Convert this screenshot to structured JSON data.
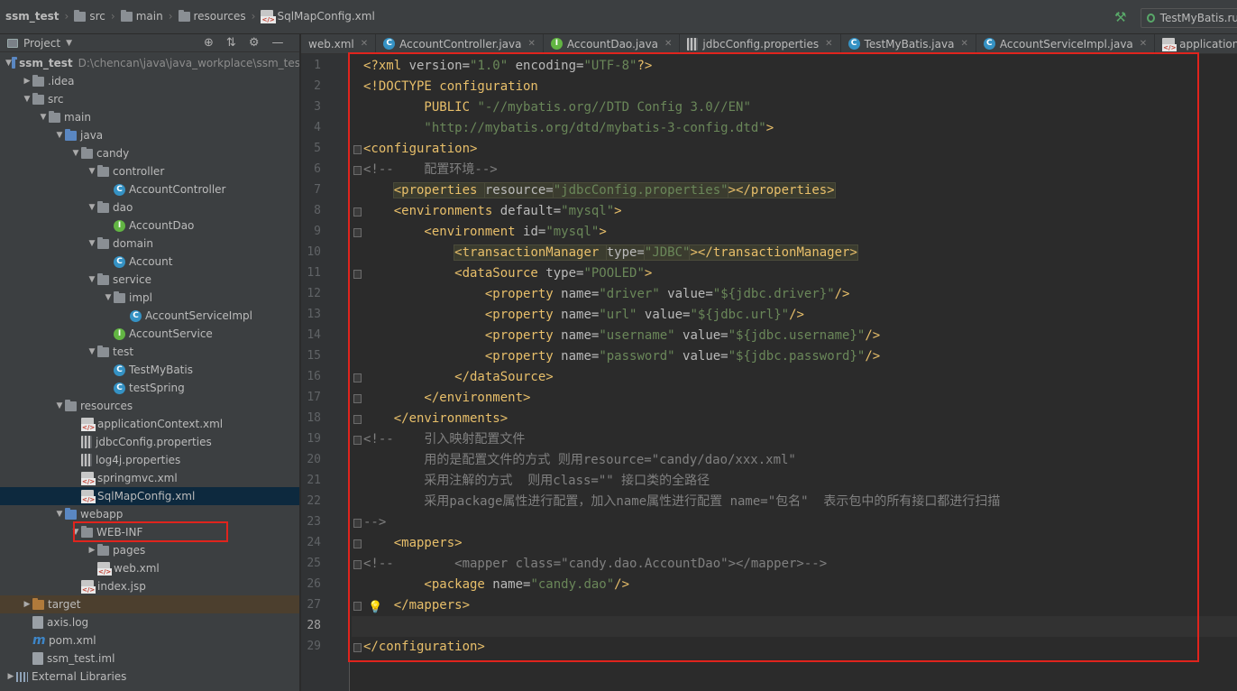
{
  "breadcrumbs": [
    "ssm_test",
    "src",
    "main",
    "resources",
    "SqlMapConfig.xml"
  ],
  "run_config": "TestMyBatis.ru",
  "sidebar": {
    "title": "Project",
    "project_path": "D:\\chencan\\java\\java_workplace\\ssm_tes",
    "nodes": [
      {
        "label": "ssm_test",
        "depth": 0,
        "arrow": "down",
        "icon": "folder-blue",
        "bold": true
      },
      {
        "label": ".idea",
        "depth": 1,
        "arrow": "right",
        "icon": "folder"
      },
      {
        "label": "src",
        "depth": 1,
        "arrow": "down",
        "icon": "folder"
      },
      {
        "label": "main",
        "depth": 2,
        "arrow": "down",
        "icon": "folder"
      },
      {
        "label": "java",
        "depth": 3,
        "arrow": "down",
        "icon": "folder-blue"
      },
      {
        "label": "candy",
        "depth": 4,
        "arrow": "down",
        "icon": "folder"
      },
      {
        "label": "controller",
        "depth": 5,
        "arrow": "down",
        "icon": "folder"
      },
      {
        "label": "AccountController",
        "depth": 6,
        "arrow": "",
        "icon": "class"
      },
      {
        "label": "dao",
        "depth": 5,
        "arrow": "down",
        "icon": "folder"
      },
      {
        "label": "AccountDao",
        "depth": 6,
        "arrow": "",
        "icon": "interface"
      },
      {
        "label": "domain",
        "depth": 5,
        "arrow": "down",
        "icon": "folder"
      },
      {
        "label": "Account",
        "depth": 6,
        "arrow": "",
        "icon": "class"
      },
      {
        "label": "service",
        "depth": 5,
        "arrow": "down",
        "icon": "folder"
      },
      {
        "label": "impl",
        "depth": 6,
        "arrow": "down",
        "icon": "folder"
      },
      {
        "label": "AccountServiceImpl",
        "depth": 7,
        "arrow": "",
        "icon": "class"
      },
      {
        "label": "AccountService",
        "depth": 6,
        "arrow": "",
        "icon": "interface"
      },
      {
        "label": "test",
        "depth": 5,
        "arrow": "down",
        "icon": "folder"
      },
      {
        "label": "TestMyBatis",
        "depth": 6,
        "arrow": "",
        "icon": "class"
      },
      {
        "label": "testSpring",
        "depth": 6,
        "arrow": "",
        "icon": "class"
      },
      {
        "label": "resources",
        "depth": 3,
        "arrow": "down",
        "icon": "folder"
      },
      {
        "label": "applicationContext.xml",
        "depth": 4,
        "arrow": "",
        "icon": "xml"
      },
      {
        "label": "jdbcConfig.properties",
        "depth": 4,
        "arrow": "",
        "icon": "props"
      },
      {
        "label": "log4j.properties",
        "depth": 4,
        "arrow": "",
        "icon": "props"
      },
      {
        "label": "springmvc.xml",
        "depth": 4,
        "arrow": "",
        "icon": "xml"
      },
      {
        "label": "SqlMapConfig.xml",
        "depth": 4,
        "arrow": "",
        "icon": "xml",
        "selected": true
      },
      {
        "label": "webapp",
        "depth": 3,
        "arrow": "down",
        "icon": "folder-blue"
      },
      {
        "label": "WEB-INF",
        "depth": 4,
        "arrow": "down",
        "icon": "folder"
      },
      {
        "label": "pages",
        "depth": 5,
        "arrow": "right",
        "icon": "folder"
      },
      {
        "label": "web.xml",
        "depth": 5,
        "arrow": "",
        "icon": "xml"
      },
      {
        "label": "index.jsp",
        "depth": 4,
        "arrow": "",
        "icon": "jsp"
      },
      {
        "label": "target",
        "depth": 1,
        "arrow": "right",
        "icon": "folder-brown",
        "target": true
      },
      {
        "label": "axis.log",
        "depth": 1,
        "arrow": "",
        "icon": "file"
      },
      {
        "label": "pom.xml",
        "depth": 1,
        "arrow": "",
        "icon": "maven"
      },
      {
        "label": "ssm_test.iml",
        "depth": 1,
        "arrow": "",
        "icon": "file"
      },
      {
        "label": "External Libraries",
        "depth": 0,
        "arrow": "right",
        "icon": "libs"
      }
    ]
  },
  "tabs": [
    {
      "label": "web.xml",
      "icon": "xml"
    },
    {
      "label": "AccountController.java",
      "icon": "class"
    },
    {
      "label": "AccountDao.java",
      "icon": "interface"
    },
    {
      "label": "jdbcConfig.properties",
      "icon": "props"
    },
    {
      "label": "TestMyBatis.java",
      "icon": "class"
    },
    {
      "label": "AccountServiceImpl.java",
      "icon": "class"
    },
    {
      "label": "applicationCont",
      "icon": "xml"
    }
  ],
  "editor": {
    "lines": [
      [
        [
          "t",
          "<?xml "
        ],
        [
          "a",
          "version="
        ],
        [
          "v",
          "\"1.0\""
        ],
        [
          "a",
          " encoding="
        ],
        [
          "v",
          "\"UTF-8\""
        ],
        [
          "t",
          "?>"
        ]
      ],
      [
        [
          "t",
          "<!DOCTYPE configuration"
        ]
      ],
      [
        [
          "t",
          "        PUBLIC "
        ],
        [
          "v",
          "\"-//mybatis.org//DTD Config 3.0//EN\""
        ]
      ],
      [
        [
          "v",
          "        \"http://mybatis.org/dtd/mybatis-3-config.dtd\""
        ],
        [
          "t",
          ">"
        ]
      ],
      [
        [
          "t",
          "<configuration>"
        ]
      ],
      [
        [
          "c",
          "<!--    配置环境-->"
        ]
      ],
      [
        [
          "pl",
          "    "
        ],
        [
          "th",
          "<properties "
        ],
        [
          "ah",
          "resource="
        ],
        [
          "vh",
          "\"jdbcConfig.properties\""
        ],
        [
          "th",
          "></properties>"
        ]
      ],
      [
        [
          "t",
          "    <environments "
        ],
        [
          "a",
          "default="
        ],
        [
          "v",
          "\"mysql\""
        ],
        [
          "t",
          ">"
        ]
      ],
      [
        [
          "t",
          "        <environment "
        ],
        [
          "a",
          "id="
        ],
        [
          "v",
          "\"mysql\""
        ],
        [
          "t",
          ">"
        ]
      ],
      [
        [
          "pl",
          "            "
        ],
        [
          "th",
          "<transactionManager "
        ],
        [
          "ah",
          "type="
        ],
        [
          "vh",
          "\"JDBC\""
        ],
        [
          "th",
          "></transactionManager>"
        ]
      ],
      [
        [
          "t",
          "            <dataSource "
        ],
        [
          "a",
          "type="
        ],
        [
          "v",
          "\"POOLED\""
        ],
        [
          "t",
          ">"
        ]
      ],
      [
        [
          "t",
          "                <property "
        ],
        [
          "a",
          "name="
        ],
        [
          "v",
          "\"driver\""
        ],
        [
          "a",
          " value="
        ],
        [
          "v",
          "\"${jdbc.driver}\""
        ],
        [
          "t",
          "/>"
        ]
      ],
      [
        [
          "t",
          "                <property "
        ],
        [
          "a",
          "name="
        ],
        [
          "v",
          "\"url\""
        ],
        [
          "a",
          " value="
        ],
        [
          "v",
          "\"${jdbc.url}\""
        ],
        [
          "t",
          "/>"
        ]
      ],
      [
        [
          "t",
          "                <property "
        ],
        [
          "a",
          "name="
        ],
        [
          "v",
          "\"username\""
        ],
        [
          "a",
          " value="
        ],
        [
          "v",
          "\"${jdbc.username}\""
        ],
        [
          "t",
          "/>"
        ]
      ],
      [
        [
          "t",
          "                <property "
        ],
        [
          "a",
          "name="
        ],
        [
          "v",
          "\"password\""
        ],
        [
          "a",
          " value="
        ],
        [
          "v",
          "\"${jdbc.password}\""
        ],
        [
          "t",
          "/>"
        ]
      ],
      [
        [
          "t",
          "            </dataSource>"
        ]
      ],
      [
        [
          "t",
          "        </environment>"
        ]
      ],
      [
        [
          "t",
          "    </environments>"
        ]
      ],
      [
        [
          "c",
          "<!--    引入映射配置文件"
        ]
      ],
      [
        [
          "c",
          "        用的是配置文件的方式 则用resource=\"candy/dao/xxx.xml\""
        ]
      ],
      [
        [
          "c",
          "        采用注解的方式  则用class=\"\" 接口类的全路径"
        ]
      ],
      [
        [
          "c",
          "        采用package属性进行配置，加入name属性进行配置 name=\"包名\"  表示包中的所有接口都进行扫描"
        ]
      ],
      [
        [
          "c",
          "-->"
        ]
      ],
      [
        [
          "t",
          "    <mappers>"
        ]
      ],
      [
        [
          "c",
          "<!--        <mapper class=\"candy.dao.AccountDao\"></mapper>-->"
        ]
      ],
      [
        [
          "t",
          "        <package "
        ],
        [
          "a",
          "name="
        ],
        [
          "v",
          "\"candy.dao\""
        ],
        [
          "t",
          "/>"
        ]
      ],
      [
        [
          "t",
          "    </mappers>"
        ]
      ],
      [],
      [
        [
          "t",
          "</configuration>"
        ]
      ]
    ],
    "line_numbers": [
      "1",
      "2",
      "3",
      "4",
      "5",
      "6",
      "7",
      "8",
      "9",
      "10",
      "11",
      "12",
      "13",
      "14",
      "15",
      "16",
      "17",
      "18",
      "19",
      "20",
      "21",
      "22",
      "23",
      "24",
      "25",
      "26",
      "27",
      "28",
      "29"
    ],
    "current_line": "28"
  }
}
